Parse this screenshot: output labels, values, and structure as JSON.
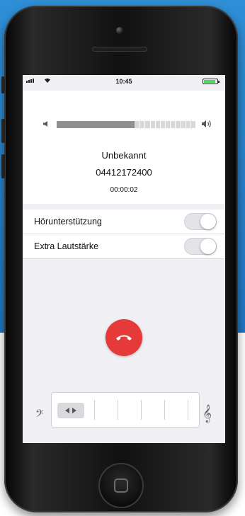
{
  "status_bar": {
    "time": "10:45",
    "signal_bars": 4,
    "battery_level": 0.9
  },
  "volume": {
    "level": 0.56
  },
  "call": {
    "caller_name": "Unbekannt",
    "caller_number": "04412172400",
    "duration": "00:00:02"
  },
  "settings": {
    "items": [
      {
        "label": "Hörunterstützung",
        "on": false
      },
      {
        "label": "Extra Lautstärke",
        "on": false
      }
    ]
  },
  "equalizer": {
    "position": 0.0
  },
  "colors": {
    "end_call": "#e5393a",
    "battery": "#4cd964",
    "background_blue": "#2f8fd6"
  },
  "icons": {
    "volume_down": "speaker-low-icon",
    "volume_up": "speaker-high-icon",
    "end_call": "phone-hangup-icon",
    "bass_clef": "bass-clef-icon",
    "treble_clef": "treble-clef-icon"
  }
}
